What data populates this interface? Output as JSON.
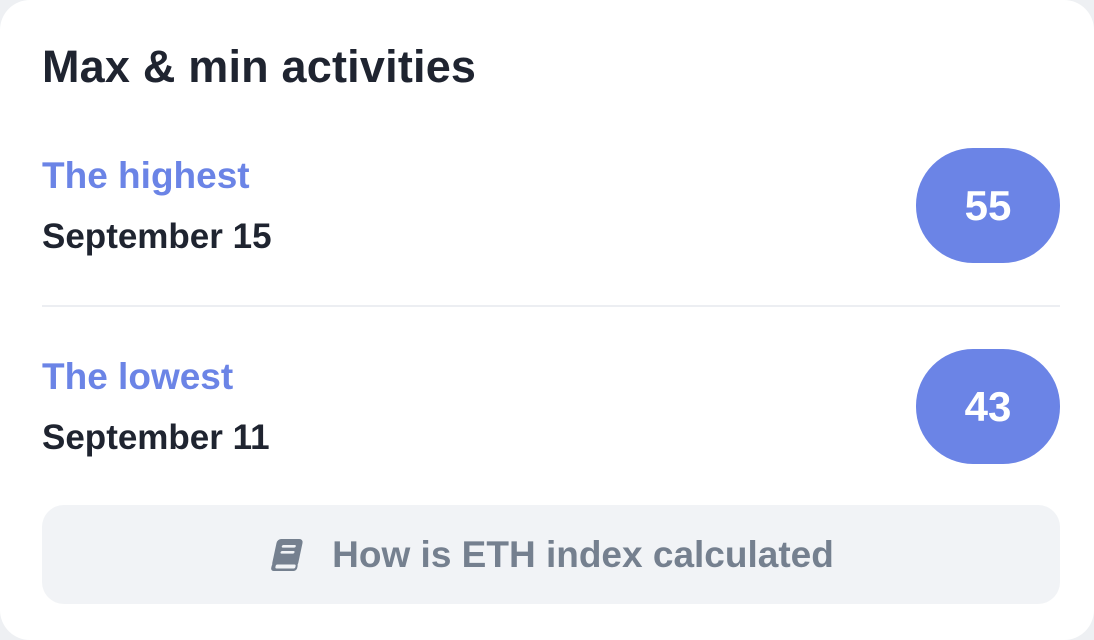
{
  "card": {
    "title": "Max & min activities"
  },
  "highest": {
    "label": "The highest",
    "date": "September 15",
    "value": "55"
  },
  "lowest": {
    "label": "The lowest",
    "date": "September 11",
    "value": "43"
  },
  "help_button": {
    "icon": "book-icon",
    "label": "How is ETH index calculated"
  },
  "colors": {
    "accent": "#6b84e6",
    "text_dark": "#1f2430",
    "help_text": "#75808f",
    "help_background": "#f1f3f6"
  }
}
